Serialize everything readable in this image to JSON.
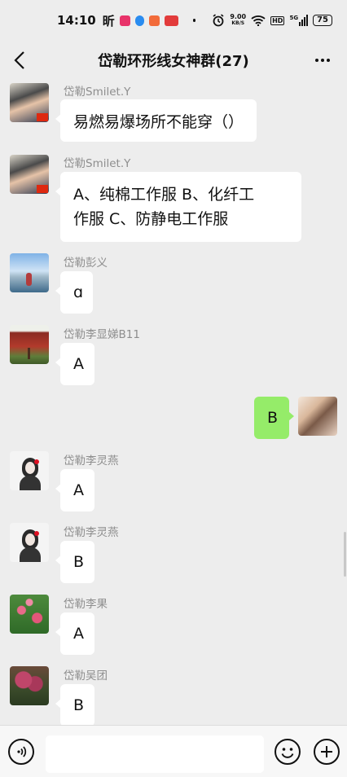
{
  "status_bar": {
    "time": "14:10",
    "net_speed_value": "9.00",
    "net_speed_unit": "KB/S",
    "hd_label": "HD",
    "signal_label": "5G",
    "battery": "75"
  },
  "header": {
    "title": "岱勒环形线女神群(27)",
    "back_icon": "chevron-left-icon",
    "more_icon": "ellipsis-icon"
  },
  "messages": [
    {
      "sender": "岱勒Smilet.Y",
      "text": "易燃易爆场所不能穿（）"
    },
    {
      "sender": "岱勒Smilet.Y",
      "lines": [
        "A、纯棉工作服   B、化纤工",
        "作服 C、防静电工作服"
      ]
    },
    {
      "sender": "岱勒彭义",
      "text": "ɑ"
    },
    {
      "sender": "岱勒李显娣B11",
      "text": "A"
    },
    {
      "sender": "",
      "text": "B",
      "self": true
    },
    {
      "sender": "岱勒李灵燕",
      "text": "A"
    },
    {
      "sender": "岱勒李灵燕",
      "text": "B"
    },
    {
      "sender": "岱勒李果",
      "text": "A"
    },
    {
      "sender": "岱勒吴团",
      "text": "B"
    }
  ],
  "input_bar": {
    "voice_icon": "voice-icon",
    "emoji_icon": "emoji-icon",
    "plus_icon": "plus-icon",
    "placeholder": ""
  },
  "colors": {
    "background": "#ededed",
    "self_bubble": "#95ec69",
    "other_bubble": "#ffffff",
    "sender_text": "#8e8e8e"
  }
}
